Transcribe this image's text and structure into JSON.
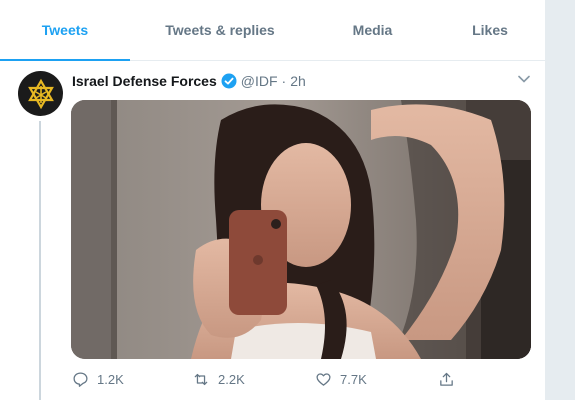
{
  "tabs": [
    {
      "label": "Tweets"
    },
    {
      "label": "Tweets & replies"
    },
    {
      "label": "Media"
    },
    {
      "label": "Likes"
    }
  ],
  "tweet": {
    "author_name": "Israel Defense Forces",
    "handle": "@IDF",
    "separator": "·",
    "time": "2h",
    "replies": "1.2K",
    "retweets": "2.2K",
    "likes": "7.7K"
  },
  "colors": {
    "accent": "#1da1f2",
    "muted": "#657786",
    "text": "#14171a",
    "divider": "#e6ecf0"
  },
  "icons": {
    "avatar": "idf-emblem-icon",
    "verified": "verified-badge-icon",
    "menu": "chevron-down-icon",
    "reply": "reply-icon",
    "retweet": "retweet-icon",
    "like": "heart-icon",
    "share": "share-icon"
  }
}
